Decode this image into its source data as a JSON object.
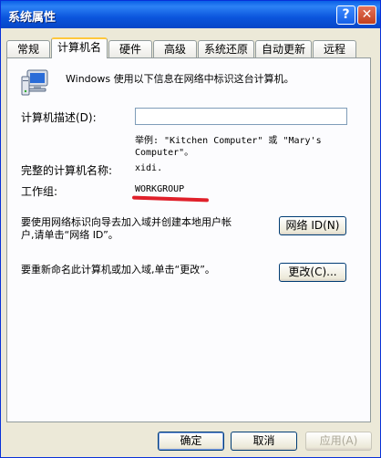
{
  "window": {
    "title": "系统属性",
    "help_label": "?",
    "close_label": "✕"
  },
  "tabs": [
    {
      "label": "常规"
    },
    {
      "label": "计算机名"
    },
    {
      "label": "硬件"
    },
    {
      "label": "高级"
    },
    {
      "label": "系统还原"
    },
    {
      "label": "自动更新"
    },
    {
      "label": "远程"
    }
  ],
  "computer_name_tab": {
    "info_text": "Windows 使用以下信息在网络中标识这台计算机。",
    "description_label": "计算机描述(D):",
    "description_value": "",
    "example_line1": "举例: \"Kitchen Computer\" 或 \"Mary's",
    "example_line2": "Computer\"。",
    "full_name_label": "完整的计算机名称:",
    "full_name_value": "xidi.",
    "workgroup_label": "工作组:",
    "workgroup_value": "WORKGROUP",
    "network_id_text_line1": "要使用网络标识向导去加入域并创建本地用户帐",
    "network_id_text_line2": "户,请单击“网络 ID”。",
    "network_id_button": "网络 ID(N)",
    "rename_text": "要重新命名此计算机或加入域,单击“更改”。",
    "change_button": "更改(C)..."
  },
  "footer": {
    "ok_button": "确定",
    "cancel_button": "取消",
    "apply_button": "应用(A)"
  },
  "colors": {
    "titlebar": "#0a5fe6",
    "dialog_bg": "#ece9d8",
    "active_tab_accent": "#ffc83c",
    "annotation_red": "#e0202a"
  }
}
